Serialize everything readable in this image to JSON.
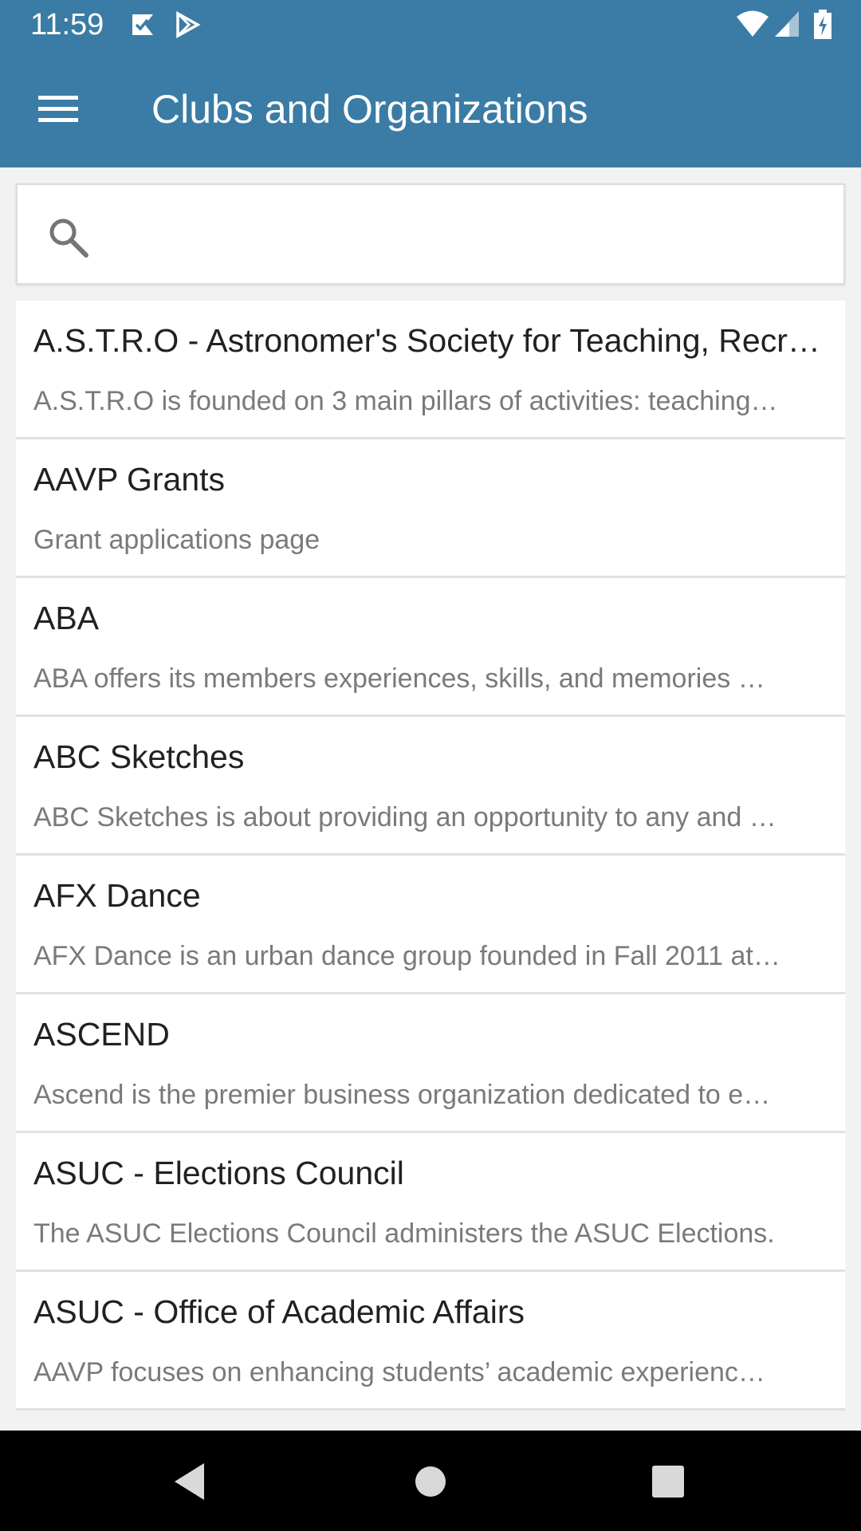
{
  "status_bar": {
    "time": "11:59",
    "notification_icons": [
      "check-flag-icon",
      "play-store-icon"
    ],
    "status_icons": [
      "wifi-icon",
      "cell-signal-icon",
      "battery-charging-icon"
    ]
  },
  "app_bar": {
    "title": "Clubs and Organizations",
    "menu_icon": "hamburger-menu-icon"
  },
  "search": {
    "icon": "search-icon",
    "value": "",
    "placeholder": ""
  },
  "clubs": [
    {
      "name": "A.S.T.R.O - Astronomer's Society for Teaching, Recr…",
      "description": "A.S.T.R.O is founded on 3 main pillars of activities: teaching…"
    },
    {
      "name": "AAVP Grants",
      "description": "Grant applications page"
    },
    {
      "name": "ABA",
      "description": "ABA offers its members experiences, skills, and memories …"
    },
    {
      "name": "ABC Sketches",
      "description": "ABC Sketches is about providing an opportunity to any and …"
    },
    {
      "name": "AFX Dance",
      "description": "AFX Dance is an urban dance group founded in Fall 2011 at…"
    },
    {
      "name": "ASCEND",
      "description": "Ascend is the premier business organization dedicated to e…"
    },
    {
      "name": "ASUC - Elections Council",
      "description": "The ASUC Elections Council administers the ASUC Elections."
    },
    {
      "name": "ASUC - Office of Academic Affairs",
      "description": "AAVP focuses on enhancing students’ academic experienc…"
    }
  ],
  "nav_bar": {
    "buttons": [
      "back-triangle-icon",
      "home-circle-icon",
      "recents-square-icon"
    ]
  },
  "colors": {
    "primary": "#3a7ca5",
    "background": "#f2f2f2",
    "title_text": "#212121",
    "description_text": "#7a7a7a"
  }
}
